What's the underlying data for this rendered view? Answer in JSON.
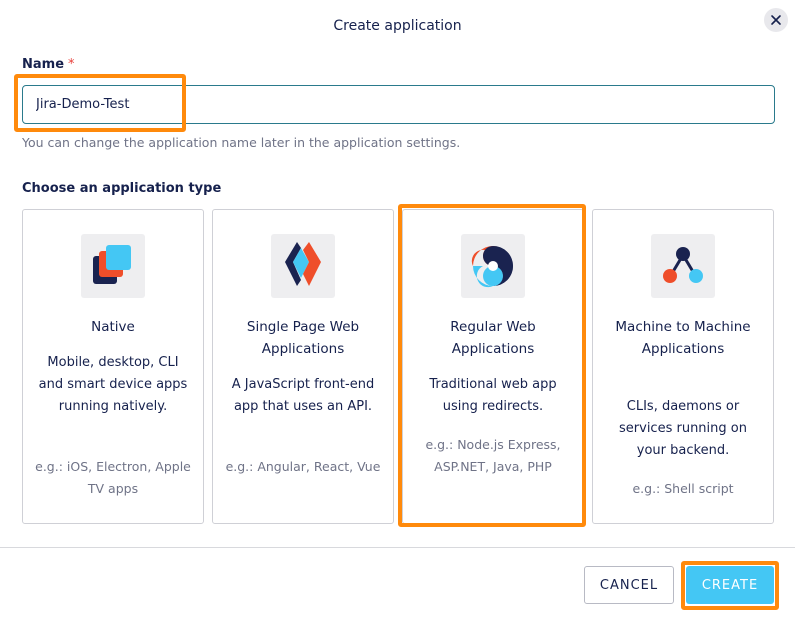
{
  "dialog": {
    "title": "Create application"
  },
  "name_field": {
    "label": "Name",
    "required_mark": "*",
    "value": "Jira-Demo-Test",
    "help": "You can change the application name later in the application settings."
  },
  "type_section": {
    "label": "Choose an application type",
    "cards": [
      {
        "icon": "native-app-icon",
        "title": "Native",
        "description": "Mobile, desktop, CLI and smart device apps running natively.",
        "examples": "e.g.: iOS, Electron, Apple TV apps"
      },
      {
        "icon": "single-page-app-icon",
        "title": "Single Page Web Applications",
        "description": "A JavaScript front-end app that uses an API.",
        "examples": "e.g.: Angular, React, Vue"
      },
      {
        "icon": "regular-web-app-icon",
        "title": "Regular Web Applications",
        "description": "Traditional web app using redirects.",
        "examples": "e.g.: Node.js Express, ASP.NET, Java, PHP"
      },
      {
        "icon": "machine-to-machine-icon",
        "title": "Machine to Machine Applications",
        "description": "CLIs, daemons or services running on your backend.",
        "examples": "e.g.: Shell script"
      }
    ]
  },
  "footer": {
    "cancel_label": "CANCEL",
    "create_label": "CREATE"
  },
  "colors": {
    "accent": "#44c7f4",
    "highlight": "#ff8a0c",
    "text": "#16214d",
    "required": "#e8403c"
  }
}
